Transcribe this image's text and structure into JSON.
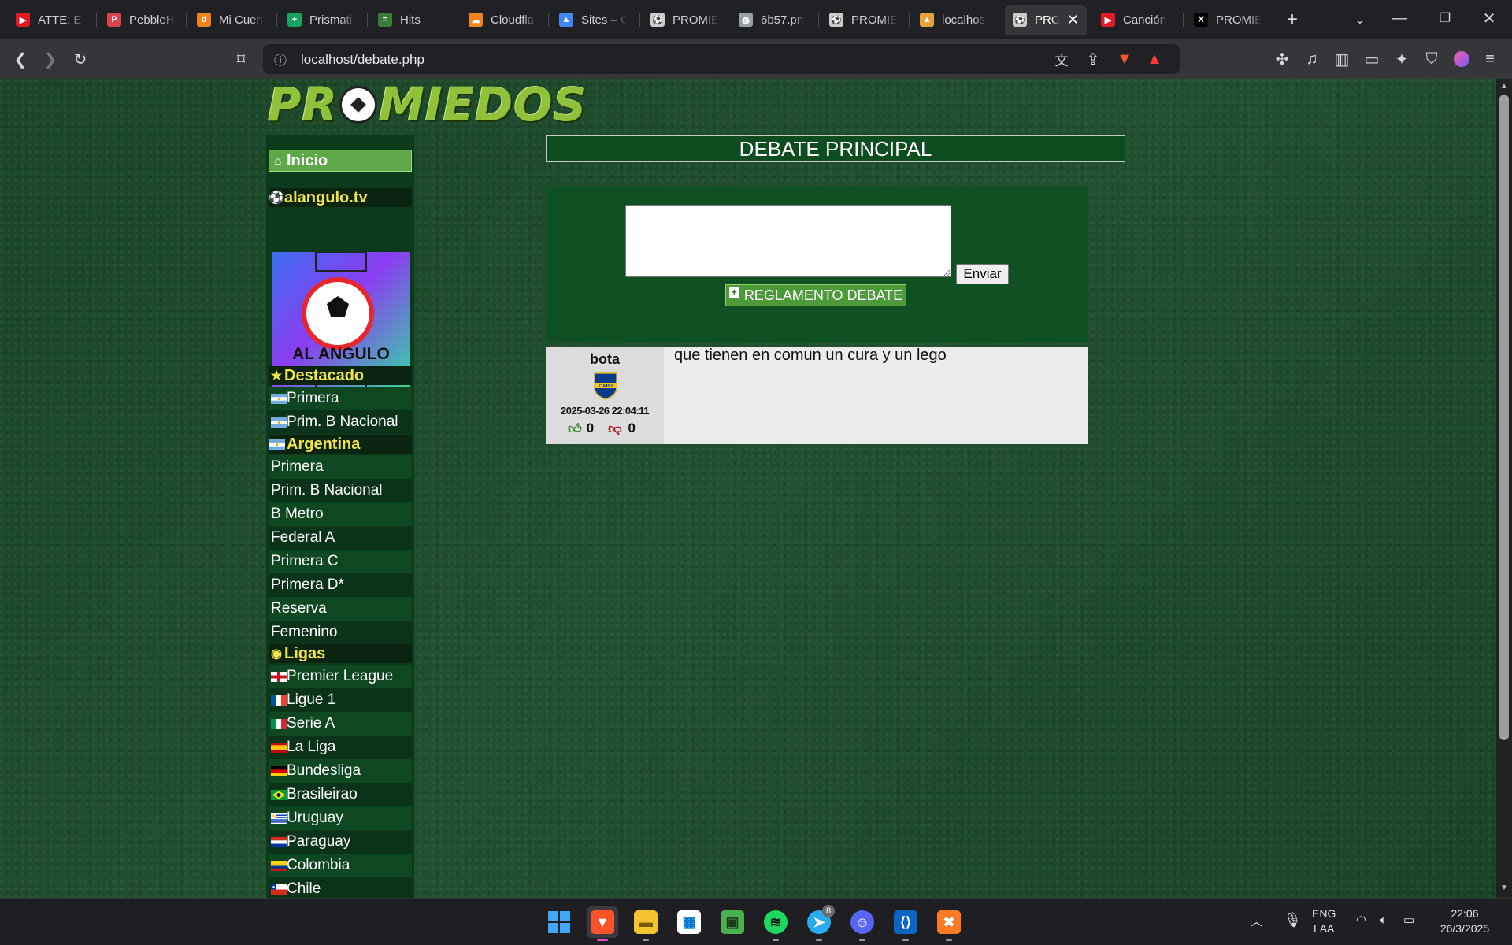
{
  "browser": {
    "tabs": [
      {
        "title": "ATTE: EL",
        "color": "#e01b24",
        "glyph": "▶"
      },
      {
        "title": "PebbleH",
        "color": "#d9444b",
        "glyph": "P"
      },
      {
        "title": "Mi Cuen",
        "color": "#f48120",
        "glyph": "d"
      },
      {
        "title": "Prismati",
        "color": "#1aa260",
        "glyph": "+"
      },
      {
        "title": "Hits",
        "color": "#3a7d3a",
        "glyph": "="
      },
      {
        "title": "Cloudfla",
        "color": "#f48120",
        "glyph": "☁"
      },
      {
        "title": "Sites – G",
        "color": "#4285f4",
        "glyph": "▲"
      },
      {
        "title": "PROMIE",
        "color": "#cccccc",
        "glyph": "⚽"
      },
      {
        "title": "6b57.pn",
        "color": "#9aa0a6",
        "glyph": "◍"
      },
      {
        "title": "PROMIE",
        "color": "#cccccc",
        "glyph": "⚽"
      },
      {
        "title": "localhos",
        "color": "#e8a33c",
        "glyph": "▲"
      },
      {
        "title": "PRO",
        "color": "#cccccc",
        "glyph": "⚽",
        "active": true
      },
      {
        "title": "Canción",
        "color": "#e01b24",
        "glyph": "▶"
      },
      {
        "title": "PROMIE",
        "color": "#000000",
        "glyph": "X"
      }
    ],
    "url": "localhost/debate.php"
  },
  "sidebar": {
    "inicio": "Inicio",
    "alangulo_header": "alangulo.tv",
    "alangulo_logo_text": "AL ANGULO",
    "destacado_header": "Destacado",
    "destacado": [
      {
        "label": "Primera",
        "flag": "ar"
      },
      {
        "label": "Prim. B Nacional",
        "flag": "ar"
      }
    ],
    "argentina_header": "Argentina",
    "argentina": [
      "Primera",
      "Prim. B Nacional",
      "B Metro",
      "Federal A",
      "Primera C",
      "Primera D*",
      "Reserva",
      "Femenino"
    ],
    "ligas_header": "Ligas",
    "ligas": [
      {
        "label": "Premier League",
        "flag": "en"
      },
      {
        "label": "Ligue 1",
        "flag": "fr"
      },
      {
        "label": "Serie A",
        "flag": "it"
      },
      {
        "label": "La Liga",
        "flag": "es"
      },
      {
        "label": "Bundesliga",
        "flag": "de"
      },
      {
        "label": "Brasileirao",
        "flag": "br"
      },
      {
        "label": "Uruguay",
        "flag": "uy"
      },
      {
        "label": "Paraguay",
        "flag": "py"
      },
      {
        "label": "Colombia",
        "flag": "co"
      },
      {
        "label": "Chile",
        "flag": "cl"
      }
    ]
  },
  "main": {
    "logo": "PROMIEDOS",
    "title": "DEBATE PRINCIPAL",
    "send_label": "Enviar",
    "rules_label": "REGLAMENTO DEBATE",
    "post": {
      "username": "bota",
      "crest": "CABJ",
      "date": "2025-03-26 22:04:11",
      "likes": "0",
      "dislikes": "0",
      "text": "que tienen en comun un cura y un lego"
    }
  },
  "taskbar": {
    "telegram_badge": "8",
    "lang_1": "ENG",
    "lang_2": "LAA",
    "time": "22:06",
    "date": "26/3/2025"
  }
}
